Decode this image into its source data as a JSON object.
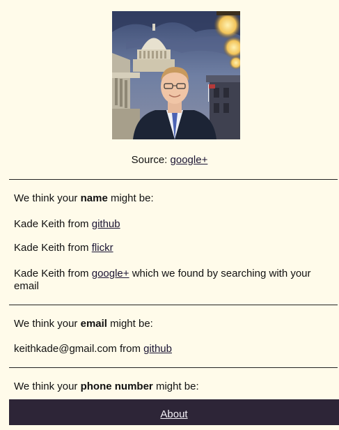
{
  "photo": {
    "alt": "Profile photo"
  },
  "source": {
    "prefix": "Source: ",
    "link": "google+"
  },
  "name_section": {
    "prefix": "We think your ",
    "bold": "name",
    "suffix": " might be:",
    "items": [
      {
        "text": "Kade Keith from ",
        "link": "github",
        "after": ""
      },
      {
        "text": "Kade Keith from ",
        "link": "flickr",
        "after": ""
      },
      {
        "text": "Kade Keith from ",
        "link": "google+",
        "after": " which we found by searching with your email"
      }
    ]
  },
  "email_section": {
    "prefix": "We think your ",
    "bold": "email",
    "suffix": " might be:",
    "items": [
      {
        "text": "keithkade@gmail.com from ",
        "link": "github"
      }
    ]
  },
  "phone_section": {
    "prefix": "We think your ",
    "bold": "phone number",
    "suffix": " might be:"
  },
  "footer": {
    "about_label": "About"
  },
  "colors": {
    "background": "#fffbea",
    "footer": "#2d2537",
    "link": "#1a1433"
  }
}
